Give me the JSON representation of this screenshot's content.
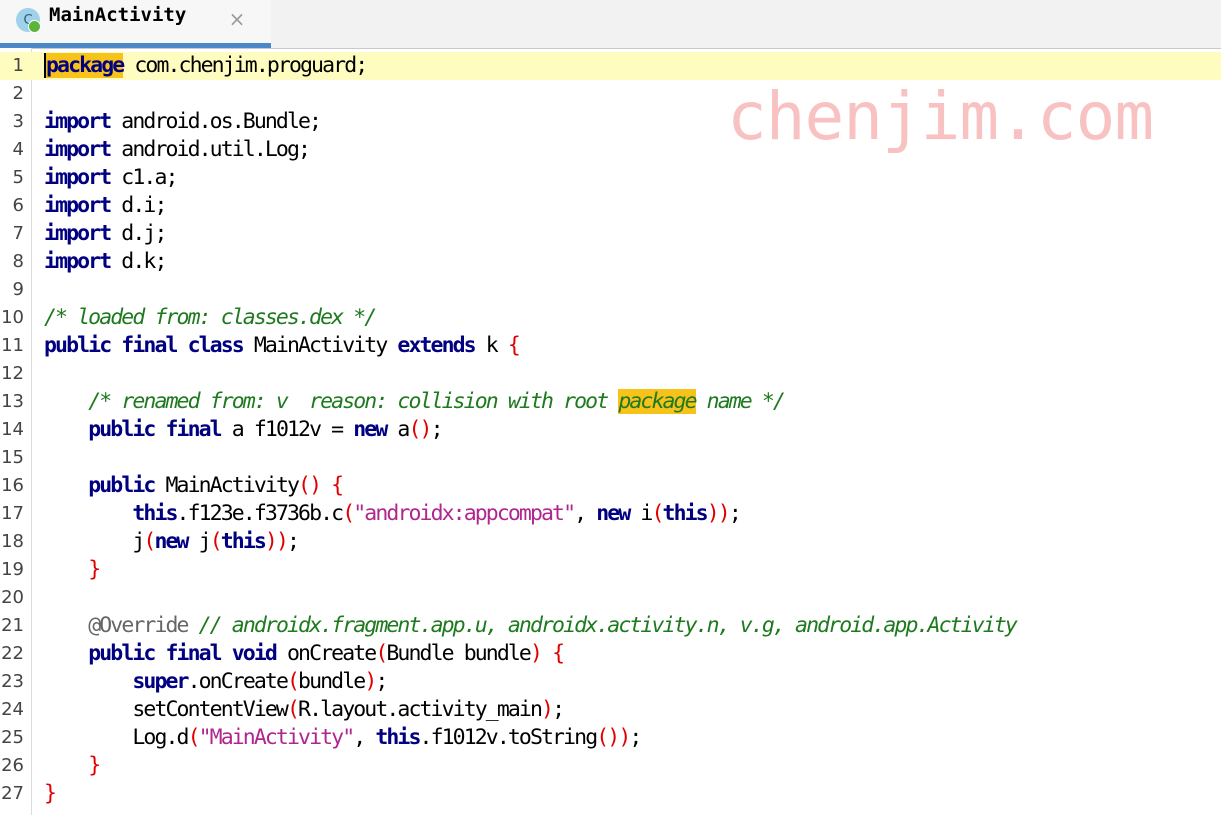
{
  "tab": {
    "icon_letter": "C",
    "title": "MainActivity",
    "close": "×"
  },
  "watermark": "chenjim.com",
  "colors": {
    "keyword": "#000080",
    "comment": "#1e7a1e",
    "string": "#b0268f",
    "bracket": "#e00000",
    "current_line": "#fefdbf",
    "search_highlight": "#f7c21a",
    "tab_accent": "#4a88c7"
  },
  "code": {
    "lines": [
      {
        "n": "1",
        "tokens": [
          [
            "kw",
            "package"
          ],
          [
            "pl",
            " com.chenjim.proguard;"
          ]
        ]
      },
      {
        "n": "2",
        "tokens": []
      },
      {
        "n": "3",
        "tokens": [
          [
            "kw",
            "import"
          ],
          [
            "pl",
            " android.os.Bundle;"
          ]
        ]
      },
      {
        "n": "4",
        "tokens": [
          [
            "kw",
            "import"
          ],
          [
            "pl",
            " android.util.Log;"
          ]
        ]
      },
      {
        "n": "5",
        "tokens": [
          [
            "kw",
            "import"
          ],
          [
            "pl",
            " c1.a;"
          ]
        ]
      },
      {
        "n": "6",
        "tokens": [
          [
            "kw",
            "import"
          ],
          [
            "pl",
            " d.i;"
          ]
        ]
      },
      {
        "n": "7",
        "tokens": [
          [
            "kw",
            "import"
          ],
          [
            "pl",
            " d.j;"
          ]
        ]
      },
      {
        "n": "8",
        "tokens": [
          [
            "kw",
            "import"
          ],
          [
            "pl",
            " d.k;"
          ]
        ]
      },
      {
        "n": "9",
        "tokens": []
      },
      {
        "n": "10",
        "tokens": [
          [
            "cm",
            "/* loaded from: classes.dex */"
          ]
        ]
      },
      {
        "n": "11",
        "tokens": [
          [
            "kw",
            "public final class"
          ],
          [
            "pl",
            " MainActivity "
          ],
          [
            "kw",
            "extends"
          ],
          [
            "pl",
            " k "
          ],
          [
            "br",
            "{"
          ]
        ]
      },
      {
        "n": "12",
        "tokens": []
      },
      {
        "n": "13",
        "tokens": [
          [
            "pl",
            "    "
          ],
          [
            "cm",
            "/* renamed from: v  reason: collision with root "
          ],
          [
            "cmhl",
            "package"
          ],
          [
            "cm",
            " name */"
          ]
        ]
      },
      {
        "n": "14",
        "tokens": [
          [
            "pl",
            "    "
          ],
          [
            "kw",
            "public final"
          ],
          [
            "pl",
            " a f1012v = "
          ],
          [
            "kw",
            "new"
          ],
          [
            "pl",
            " a"
          ],
          [
            "br",
            "()"
          ],
          [
            "pl",
            ";"
          ]
        ]
      },
      {
        "n": "15",
        "tokens": []
      },
      {
        "n": "16",
        "tokens": [
          [
            "pl",
            "    "
          ],
          [
            "kw",
            "public"
          ],
          [
            "pl",
            " MainActivity"
          ],
          [
            "br",
            "()"
          ],
          [
            "pl",
            " "
          ],
          [
            "br",
            "{"
          ]
        ]
      },
      {
        "n": "17",
        "tokens": [
          [
            "pl",
            "        "
          ],
          [
            "kw",
            "this"
          ],
          [
            "pl",
            ".f123e.f3736b.c"
          ],
          [
            "br",
            "("
          ],
          [
            "st",
            "\"androidx:appcompat\""
          ],
          [
            "pl",
            ", "
          ],
          [
            "kw",
            "new"
          ],
          [
            "pl",
            " i"
          ],
          [
            "br",
            "("
          ],
          [
            "kw",
            "this"
          ],
          [
            "br",
            "))"
          ],
          [
            "pl",
            ";"
          ]
        ]
      },
      {
        "n": "18",
        "tokens": [
          [
            "pl",
            "        j"
          ],
          [
            "br",
            "("
          ],
          [
            "kw",
            "new"
          ],
          [
            "pl",
            " j"
          ],
          [
            "br",
            "("
          ],
          [
            "kw",
            "this"
          ],
          [
            "br",
            "))"
          ],
          [
            "pl",
            ";"
          ]
        ]
      },
      {
        "n": "19",
        "tokens": [
          [
            "pl",
            "    "
          ],
          [
            "br",
            "}"
          ]
        ]
      },
      {
        "n": "20",
        "tokens": []
      },
      {
        "n": "21",
        "tokens": [
          [
            "pl",
            "    "
          ],
          [
            "an",
            "@Override"
          ],
          [
            "pl",
            " "
          ],
          [
            "cm",
            "// androidx.fragment.app.u, androidx.activity.n, v.g, android.app.Activity"
          ]
        ]
      },
      {
        "n": "22",
        "tokens": [
          [
            "pl",
            "    "
          ],
          [
            "kw",
            "public final void"
          ],
          [
            "pl",
            " onCreate"
          ],
          [
            "br",
            "("
          ],
          [
            "pl",
            "Bundle bundle"
          ],
          [
            "br",
            ")"
          ],
          [
            "pl",
            " "
          ],
          [
            "br",
            "{"
          ]
        ]
      },
      {
        "n": "23",
        "tokens": [
          [
            "pl",
            "        "
          ],
          [
            "kw",
            "super"
          ],
          [
            "pl",
            ".onCreate"
          ],
          [
            "br",
            "("
          ],
          [
            "pl",
            "bundle"
          ],
          [
            "br",
            ")"
          ],
          [
            "pl",
            ";"
          ]
        ]
      },
      {
        "n": "24",
        "tokens": [
          [
            "pl",
            "        setContentView"
          ],
          [
            "br",
            "("
          ],
          [
            "pl",
            "R.layout.activity_main"
          ],
          [
            "br",
            ")"
          ],
          [
            "pl",
            ";"
          ]
        ]
      },
      {
        "n": "25",
        "tokens": [
          [
            "pl",
            "        Log.d"
          ],
          [
            "br",
            "("
          ],
          [
            "st",
            "\"MainActivity\""
          ],
          [
            "pl",
            ", "
          ],
          [
            "kw",
            "this"
          ],
          [
            "pl",
            ".f1012v.toString"
          ],
          [
            "br",
            "())"
          ],
          [
            "pl",
            ";"
          ]
        ]
      },
      {
        "n": "26",
        "tokens": [
          [
            "pl",
            "    "
          ],
          [
            "br",
            "}"
          ]
        ]
      },
      {
        "n": "27",
        "tokens": [
          [
            "br",
            "}"
          ]
        ]
      }
    ]
  }
}
